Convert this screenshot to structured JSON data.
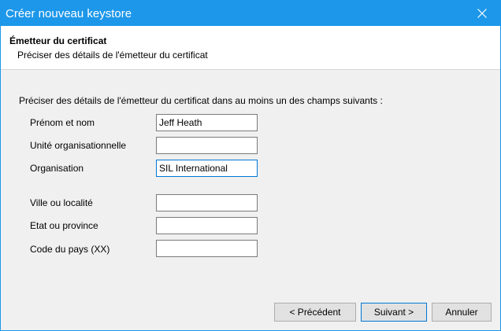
{
  "window": {
    "title": "Créer nouveau keystore"
  },
  "header": {
    "title": "Émetteur du certificat",
    "subtitle": "Préciser des détails de l'émetteur du certificat"
  },
  "form": {
    "instructions": "Préciser des détails de l'émetteur du certificat dans au moins un des champs suivants :",
    "fields": [
      {
        "label": "Prénom et nom",
        "value": "Jeff Heath"
      },
      {
        "label": "Unité organisationnelle",
        "value": ""
      },
      {
        "label": "Organisation",
        "value": "SIL International"
      },
      {
        "label": "Ville ou localité",
        "value": ""
      },
      {
        "label": "Etat ou province",
        "value": ""
      },
      {
        "label": "Code du pays (XX)",
        "value": ""
      }
    ]
  },
  "buttons": {
    "back": "< Précédent",
    "next": "Suivant >",
    "cancel": "Annuler"
  },
  "colors": {
    "titlebar": "#1c97ea",
    "accent": "#0078d7"
  }
}
